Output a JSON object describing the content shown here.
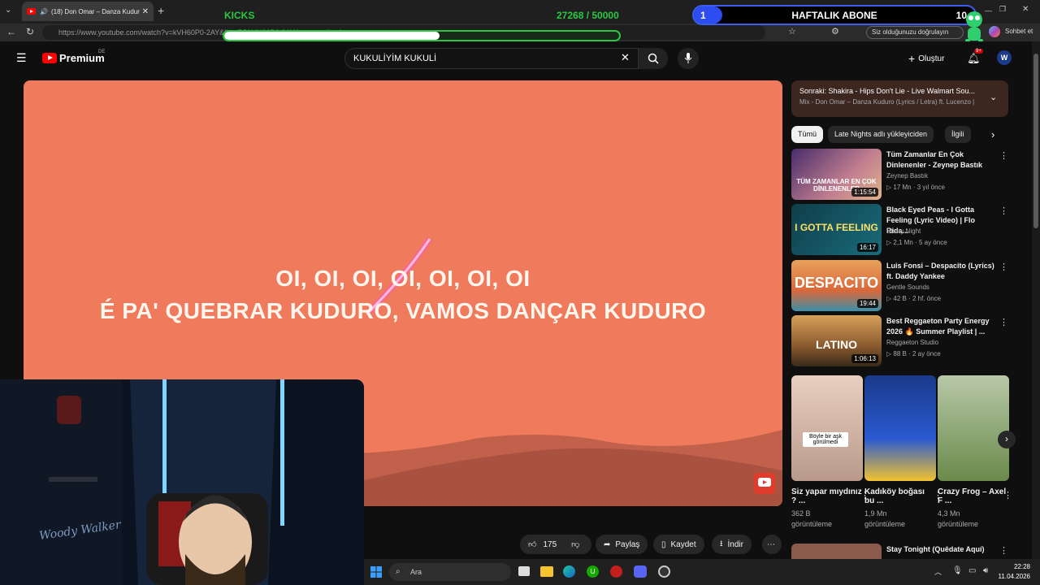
{
  "browser": {
    "tab_title": "(18) Don Omar – Danza Kudur",
    "url": "https://www.youtube.com/watch?v=kVH60P0-2AY&list=RDkVH60P0-2AY&start_radio=1",
    "verify_label": "Siz olduğunuzu doğrulayın",
    "chat_label": "Sohbet et"
  },
  "overlay": {
    "kicks_label": "KICKS",
    "kicks_count": "27268 / 50000",
    "kicks_progress": 0.545,
    "sub_left": "1",
    "sub_title": "HAFTALIK ABONE",
    "sub_right": "10",
    "sub_progress": 0.1
  },
  "header": {
    "logo_text": "Premium",
    "region": "DE",
    "search_value": "KUKULİYİM KUKULİ",
    "create_label": "Oluştur",
    "notif_count": "9+"
  },
  "player": {
    "lyric_line1": "OI, OI, OI, OI, OI, OI, OI",
    "lyric_line2": "É PA' QUEBRAR KUDURO, VAMOS DANÇAR KUDURO",
    "bg_color": "#f07a5c"
  },
  "actions": {
    "like_count": "175",
    "share": "Paylaş",
    "save": "Kaydet",
    "download": "İndir"
  },
  "sidebar": {
    "next_title": "Sonraki: Shakira - Hips Don't Lie - Live Walmart Sou...",
    "next_sub": "Mix - Don Omar – Danza Kuduro (Lyrics / Letra) ft. Lucenzo |...",
    "chips": [
      "Tümü",
      "Late Nights adlı yükleyiciden",
      "İlgili"
    ],
    "videos": [
      {
        "title": "Tüm Zamanlar En Çok Dinlenenler - Zeynep Bastık",
        "channel": "Zeynep Bastık",
        "views": "17 Mn",
        "age": "3 yıl önce",
        "duration": "1:15:54",
        "thumb_text": "TÜM ZAMANLAR EN ÇOK DİNLENENLER"
      },
      {
        "title": "Black Eyed Peas - I Gotta Feeling (Lyric Video) | Flo Rida...",
        "channel": "Starry Night",
        "views": "2,1 Mn",
        "age": "5 ay önce",
        "duration": "16:17",
        "thumb_text": "I GOTTA FEELING"
      },
      {
        "title": "Luis Fonsi – Despacito (Lyrics) ft. Daddy Yankee",
        "channel": "Gentle Sounds",
        "views": "42 B",
        "age": "2 hf. önce",
        "duration": "19:44",
        "thumb_text": "DESPACITO"
      },
      {
        "title": "Best Reggaeton Party Energy 2026 🔥 Summer Playlist | ...",
        "channel": "Reggaeton Studio",
        "views": "88 B",
        "age": "2 ay önce",
        "duration": "1:06:13",
        "thumb_text": "LATINO"
      }
    ],
    "shorts": [
      {
        "title": "Siz yapar mıydınız ? ...",
        "views": "362 B",
        "unit": "görüntüleme",
        "caption": "Böyle bir aşk görülmedi"
      },
      {
        "title": "Kadıköy boğası bu ...",
        "views": "1,9 Mn",
        "unit": "görüntüleme"
      },
      {
        "title": "Crazy Frog – Axel F ...",
        "views": "4,3 Mn",
        "unit": "görüntüleme"
      }
    ],
    "next_video_title": "Stay Tonight (Quêdate Aquí)"
  },
  "taskbar": {
    "search_placeholder": "Ara",
    "time": "22:28",
    "date": "11.04.2026"
  },
  "webcam": {
    "watermark": "Woody Walker"
  }
}
